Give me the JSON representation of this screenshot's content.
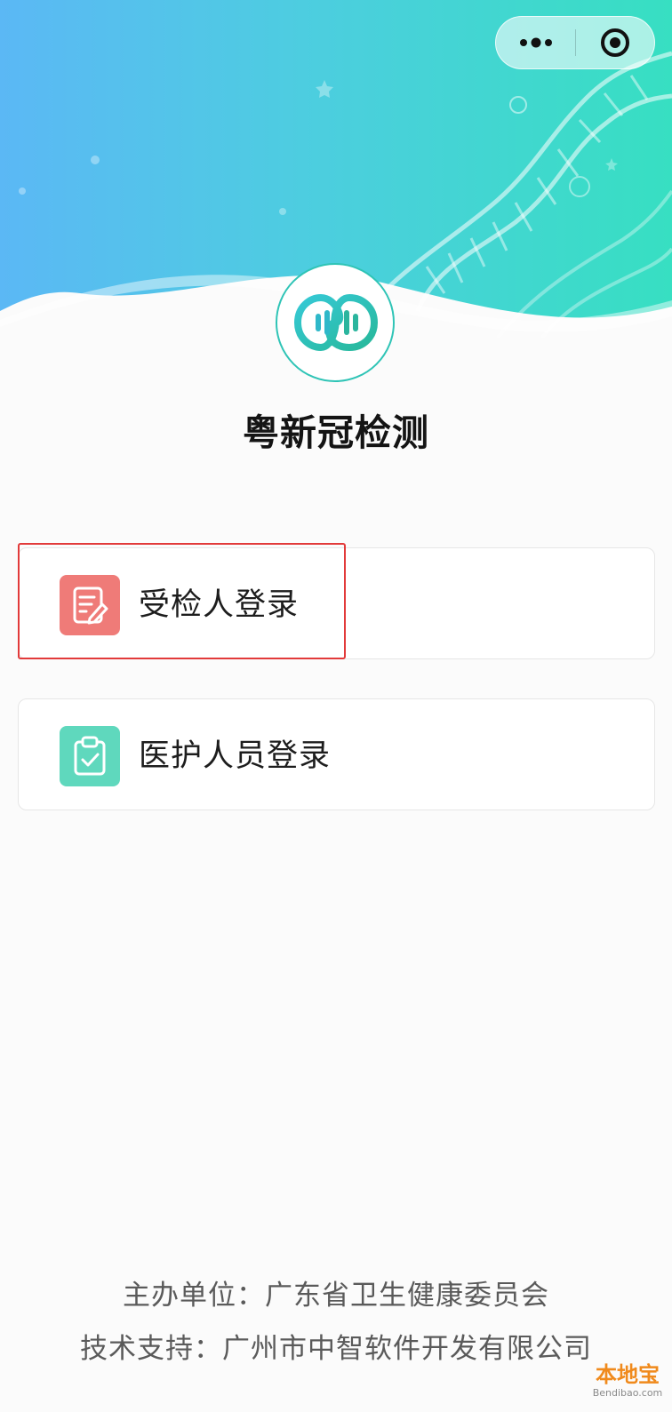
{
  "header": {
    "capsule": {
      "more_icon": "more-dots-icon",
      "close_icon": "target-close-icon"
    },
    "logo_icon": "dna-sound-logo"
  },
  "app": {
    "title": "粤新冠检测"
  },
  "login_options": [
    {
      "label": "受检人登录",
      "icon": "edit-document-icon",
      "icon_color": "#ef7b78",
      "highlighted": true
    },
    {
      "label": "医护人员登录",
      "icon": "clipboard-check-icon",
      "icon_color": "#5fd8bd",
      "highlighted": false
    }
  ],
  "footer": {
    "organizer": "主办单位：广东省卫生健康委员会",
    "tech_support": "技术支持：广州市中智软件开发有限公司"
  },
  "watermark": {
    "main": "本地宝",
    "sub": "Bendibao.com"
  },
  "colors": {
    "header_gradient_start": "#5bb8f5",
    "header_gradient_end": "#37dfc2",
    "highlight": "#e23a3a",
    "brand_teal": "#2fc4b6"
  }
}
